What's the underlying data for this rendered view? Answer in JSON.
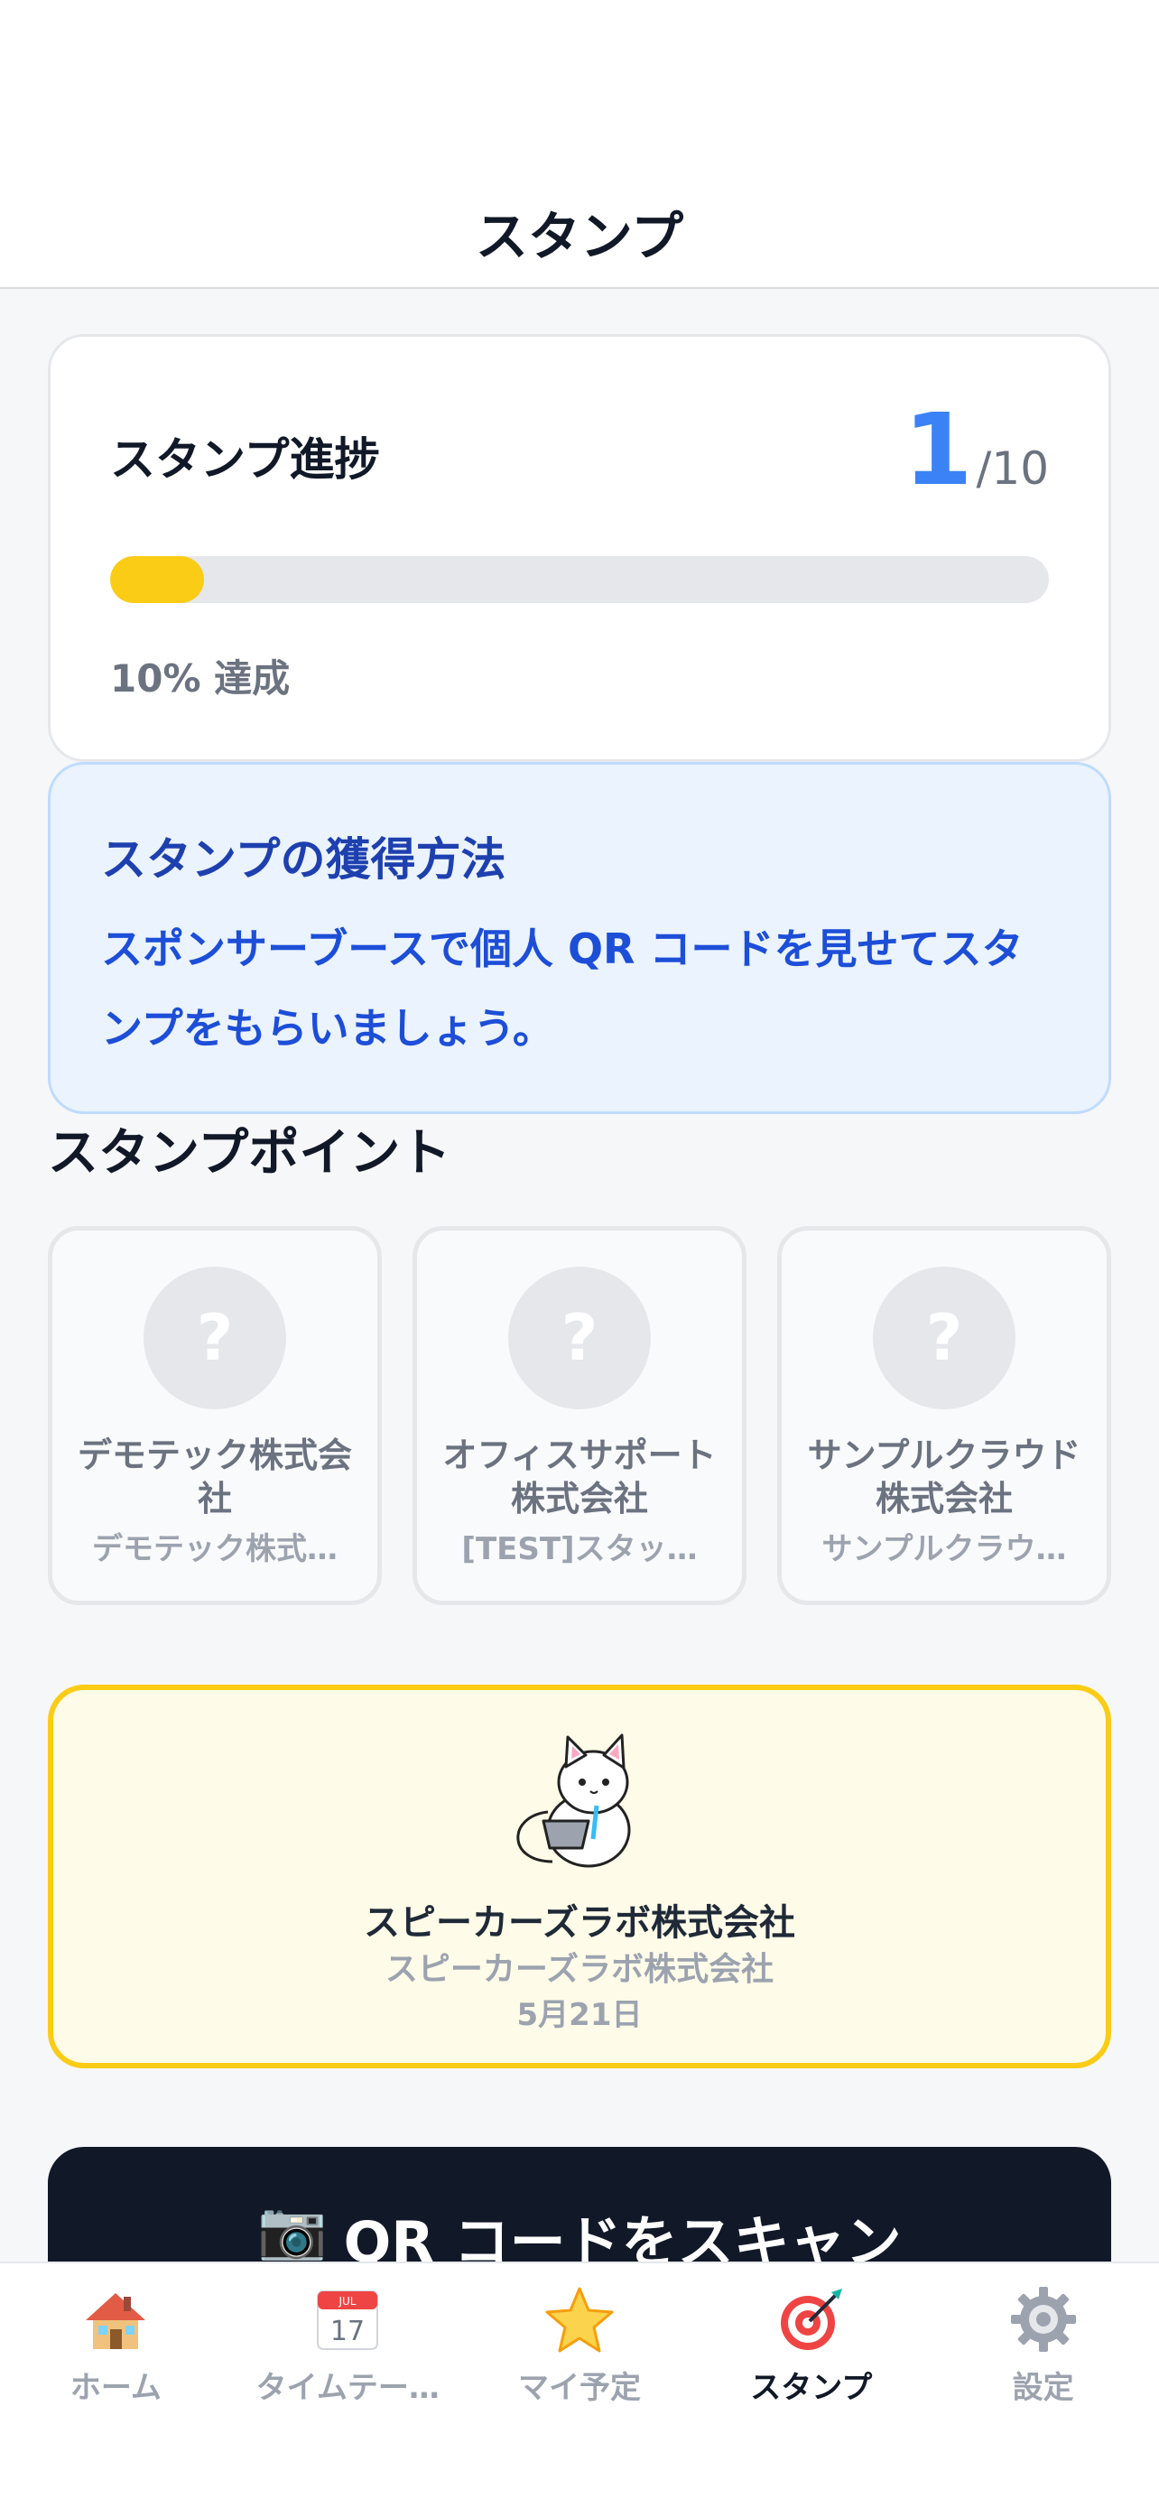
{
  "header": {
    "title": "スタンプ"
  },
  "progress": {
    "title": "スタンプ進捗",
    "count": "1",
    "total": "/10",
    "fraction": 0.1,
    "percent_label": "10% 達成"
  },
  "info": {
    "title": "スタンプの獲得方法",
    "body": "スポンサーブースで個人 QR コードを見せてスタンプをもらいましょう。"
  },
  "points_section": {
    "title": "スタンプポイント",
    "items": [
      {
        "mark": "?",
        "name": "デモテック株式会社",
        "sub": "デモテック株式…"
      },
      {
        "mark": "?",
        "name": "オフィスサポート株式会社",
        "sub": "[TEST]スタッ…"
      },
      {
        "mark": "?",
        "name": "サンプルクラウド株式会社",
        "sub": "サンプルクラウ…"
      }
    ]
  },
  "acquired": {
    "name": "スピーカーズラボ株式会社",
    "sub": "スピーカーズラボ株式会社",
    "date": "5月21日",
    "icon": "cat-mascot-icon"
  },
  "scan_button": {
    "icon": "📷",
    "label": "QR コードをスキャン"
  },
  "tabbar": {
    "tabs": [
      {
        "label": "ホーム",
        "icon": "house-icon"
      },
      {
        "label": "タイムテー…",
        "icon": "calendar-icon",
        "calendar_month": "JUL",
        "calendar_day": "17"
      },
      {
        "label": "マイ予定",
        "icon": "star-icon"
      },
      {
        "label": "スタンプ",
        "icon": "target-icon"
      },
      {
        "label": "設定",
        "icon": "gear-icon"
      }
    ],
    "active_index": 3
  },
  "colors": {
    "accent_blue": "#3b82f6",
    "progress_yellow": "#facc15",
    "dark_button": "#111827"
  }
}
